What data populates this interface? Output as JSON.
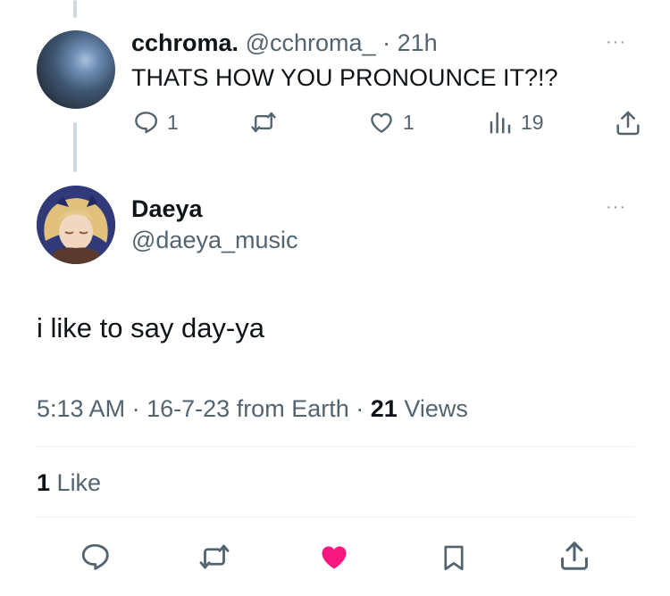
{
  "reply_tweet": {
    "display_name": "cchroma.",
    "handle": "@cchroma_",
    "separator": "·",
    "time_ago": "21h",
    "more_label": "···",
    "text": "THATS HOW YOU PRONOUNCE IT?!?",
    "replies": "1",
    "likes": "1",
    "views": "19"
  },
  "main_tweet": {
    "display_name": "Daeya",
    "handle": "@daeya_music",
    "more_label": "···",
    "text": "i like to say day-ya",
    "time": "5:13 AM",
    "sep1": "·",
    "date": "16-7-23",
    "source": "from Earth",
    "sep2": "·",
    "views_count": "21",
    "views_label": "Views",
    "likes_count": "1",
    "likes_label": "Like"
  },
  "colors": {
    "like_active": "#f91880",
    "muted": "#536471",
    "text": "#0f1419"
  }
}
